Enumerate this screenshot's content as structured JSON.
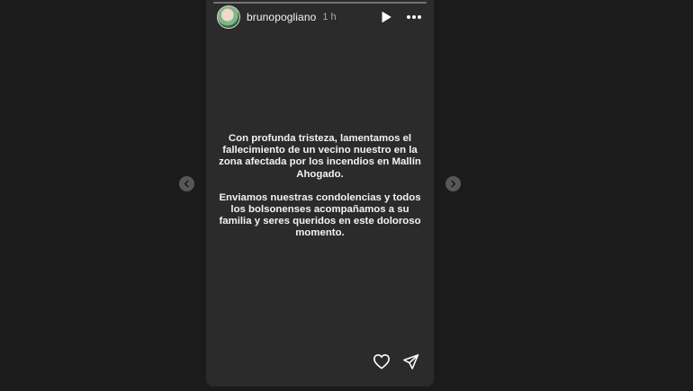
{
  "story": {
    "username": "brunopogliano",
    "time": "1 h",
    "progress": 0.0,
    "text": {
      "paragraph_1": "Con profunda tristeza, lamentamos el fallecimiento de un vecino nuestro en la zona afectada por los incendios en Mallín Ahogado.",
      "paragraph_2": "Enviamos nuestras condolencias y todos los bolsonenses acompañamos a su familia y seres queridos en este doloroso momento."
    },
    "background_color": "#2b2b2b"
  },
  "icons": {
    "avatar": "profile-avatar",
    "play": "play-icon",
    "more": "more-icon",
    "like": "heart-icon",
    "share": "send-icon",
    "prev": "chevron-left-icon",
    "next": "chevron-right-icon"
  }
}
